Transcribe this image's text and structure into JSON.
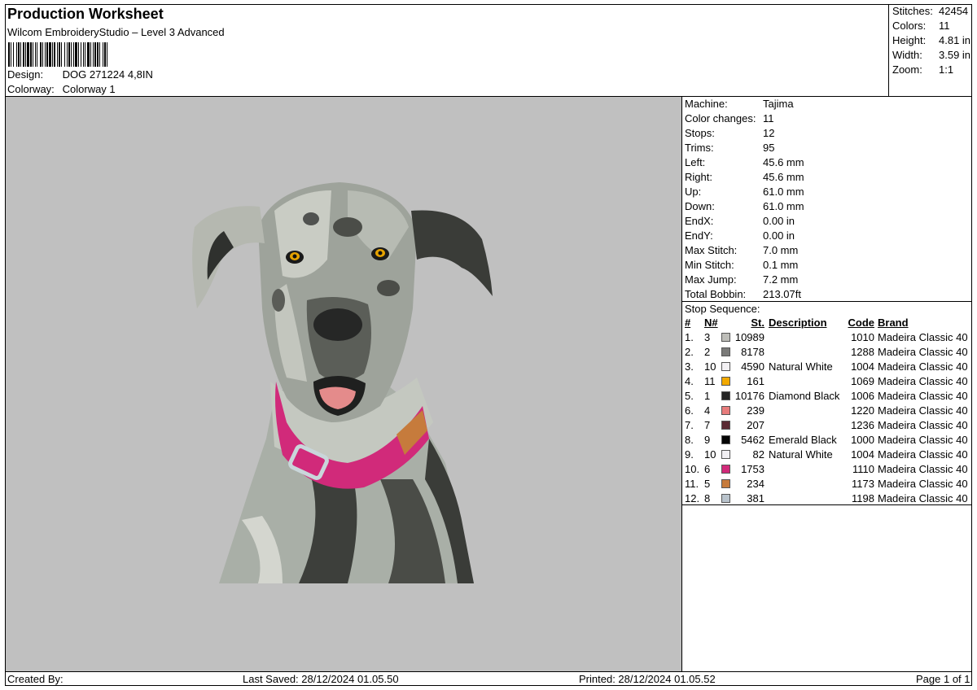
{
  "header": {
    "title": "Production Worksheet",
    "software": "Wilcom EmbroideryStudio – Level 3 Advanced",
    "design_label": "Design:",
    "design_value": "DOG 271224 4,8IN",
    "colorway_label": "Colorway:",
    "colorway_value": "Colorway 1"
  },
  "summary": [
    {
      "label": "Stitches:",
      "value": "42454"
    },
    {
      "label": "Colors:",
      "value": "11"
    },
    {
      "label": "Height:",
      "value": "4.81 in"
    },
    {
      "label": "Width:",
      "value": "3.59 in"
    },
    {
      "label": "Zoom:",
      "value": "1:1"
    }
  ],
  "machine": [
    {
      "label": "Machine:",
      "value": "Tajima"
    },
    {
      "label": "Color changes:",
      "value": "11"
    },
    {
      "label": "Stops:",
      "value": "12"
    },
    {
      "label": "Trims:",
      "value": "95"
    },
    {
      "label": "Left:",
      "value": "45.6 mm"
    },
    {
      "label": "Right:",
      "value": "45.6 mm"
    },
    {
      "label": "Up:",
      "value": "61.0 mm"
    },
    {
      "label": "Down:",
      "value": "61.0 mm"
    },
    {
      "label": "EndX:",
      "value": "0.00 in"
    },
    {
      "label": "EndY:",
      "value": "0.00 in"
    },
    {
      "label": "Max Stitch:",
      "value": "7.0 mm"
    },
    {
      "label": "Min Stitch:",
      "value": "0.1 mm"
    },
    {
      "label": "Max Jump:",
      "value": "7.2 mm"
    },
    {
      "label": "Total Bobbin:",
      "value": "213.07ft"
    }
  ],
  "stops": {
    "title": "Stop Sequence:",
    "headers": {
      "idx": "#",
      "n": "N#",
      "st": "St.",
      "desc": "Description",
      "code": "Code",
      "brand": "Brand"
    },
    "rows": [
      {
        "idx": "1.",
        "n": "3",
        "color": "#bdbdb8",
        "st": "10989",
        "desc": "",
        "code": "1010",
        "brand": "Madeira Classic 40"
      },
      {
        "idx": "2.",
        "n": "2",
        "color": "#7a7a78",
        "st": "8178",
        "desc": "",
        "code": "1288",
        "brand": "Madeira Classic 40"
      },
      {
        "idx": "3.",
        "n": "10",
        "color": "#f3f1f4",
        "st": "4590",
        "desc": "Natural White",
        "code": "1004",
        "brand": "Madeira Classic 40"
      },
      {
        "idx": "4.",
        "n": "11",
        "color": "#f2a900",
        "st": "161",
        "desc": "",
        "code": "1069",
        "brand": "Madeira Classic 40"
      },
      {
        "idx": "5.",
        "n": "1",
        "color": "#262626",
        "st": "10176",
        "desc": "Diamond Black",
        "code": "1006",
        "brand": "Madeira Classic 40"
      },
      {
        "idx": "6.",
        "n": "4",
        "color": "#e87c7c",
        "st": "239",
        "desc": "",
        "code": "1220",
        "brand": "Madeira Classic 40"
      },
      {
        "idx": "7.",
        "n": "7",
        "color": "#5a2a33",
        "st": "207",
        "desc": "",
        "code": "1236",
        "brand": "Madeira Classic 40"
      },
      {
        "idx": "8.",
        "n": "9",
        "color": "#050505",
        "st": "5462",
        "desc": "Emerald Black",
        "code": "1000",
        "brand": "Madeira Classic 40"
      },
      {
        "idx": "9.",
        "n": "10",
        "color": "#f1eff3",
        "st": "82",
        "desc": "Natural White",
        "code": "1004",
        "brand": "Madeira Classic 40"
      },
      {
        "idx": "10.",
        "n": "6",
        "color": "#d12a7a",
        "st": "1753",
        "desc": "",
        "code": "1110",
        "brand": "Madeira Classic 40"
      },
      {
        "idx": "11.",
        "n": "5",
        "color": "#c67b3c",
        "st": "234",
        "desc": "",
        "code": "1173",
        "brand": "Madeira Classic 40"
      },
      {
        "idx": "12.",
        "n": "8",
        "color": "#b9c3cc",
        "st": "381",
        "desc": "",
        "code": "1198",
        "brand": "Madeira Classic 40"
      }
    ]
  },
  "footer": {
    "created_by": "Created By:",
    "last_saved": "Last Saved: 28/12/2024 01.05.50",
    "printed": "Printed: 28/12/2024 01.05.52",
    "page": "Page 1 of 1"
  }
}
